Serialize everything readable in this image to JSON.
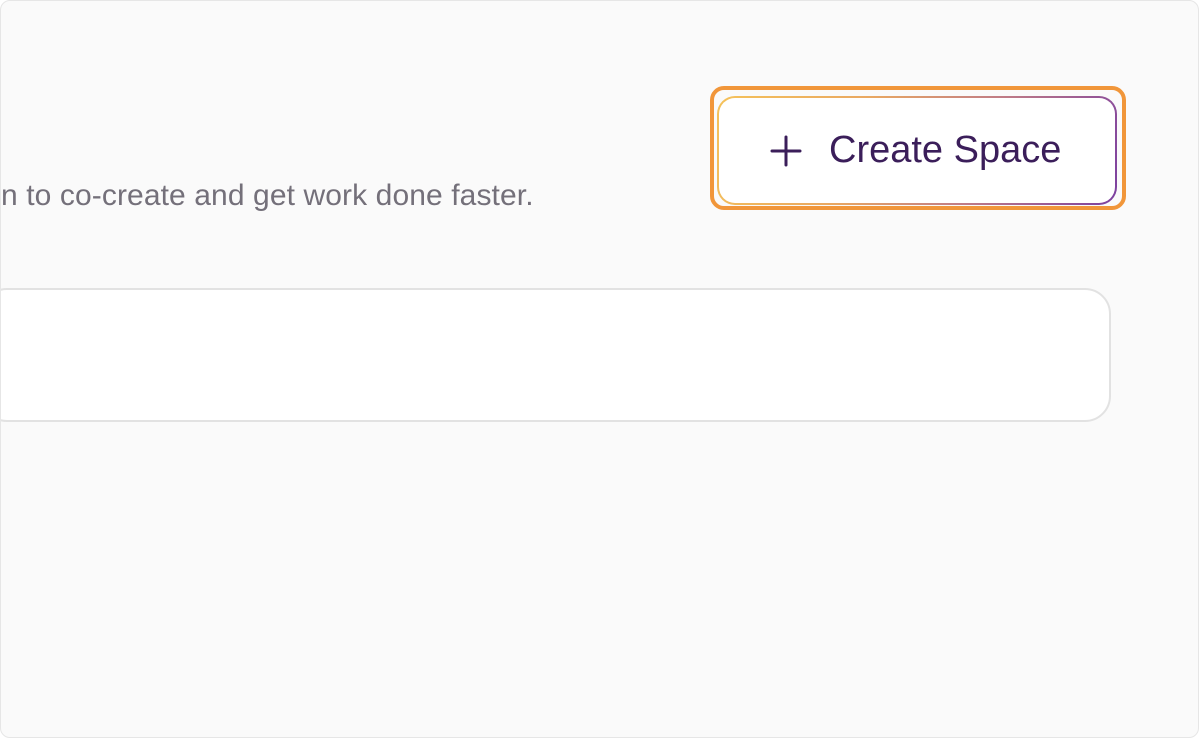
{
  "header": {
    "subtitle": "n to co-create and get work done faster."
  },
  "actions": {
    "create_space_label": "Create Space",
    "create_space_icon": "plus-icon"
  },
  "search": {
    "value": "",
    "placeholder": ""
  },
  "colors": {
    "accent_highlight": "#f1963a",
    "button_text": "#3b1e5a",
    "gradient_start": "#f5c25a",
    "gradient_end": "#7b3fa0"
  }
}
